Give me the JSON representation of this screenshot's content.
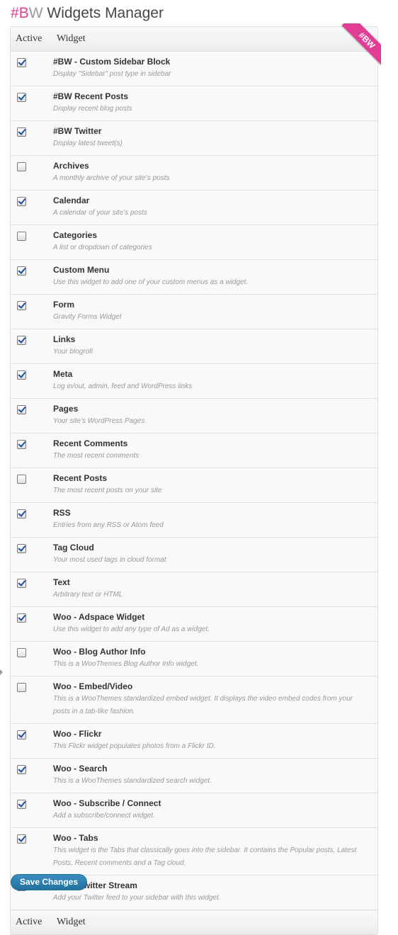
{
  "header": {
    "brand_hash": "#",
    "brand_b": "B",
    "brand_w": "W",
    "title": "Widgets Manager"
  },
  "ribbon": {
    "label": "#BW"
  },
  "columns": {
    "active": "Active",
    "widget": "Widget"
  },
  "widgets": [
    {
      "name": "#BW - Custom Sidebar Block",
      "desc": "Display \"Sidebar\" post type in sidebar",
      "active": true
    },
    {
      "name": "#BW Recent Posts",
      "desc": "Display recent blog posts",
      "active": true
    },
    {
      "name": "#BW Twitter",
      "desc": "Display latest tweet(s)",
      "active": true
    },
    {
      "name": "Archives",
      "desc": "A monthly archive of your site’s posts",
      "active": false
    },
    {
      "name": "Calendar",
      "desc": "A calendar of your site’s posts",
      "active": true
    },
    {
      "name": "Categories",
      "desc": "A list or dropdown of categories",
      "active": false
    },
    {
      "name": "Custom Menu",
      "desc": "Use this widget to add one of your custom menus as a widget.",
      "active": true
    },
    {
      "name": "Form",
      "desc": "Gravity Forms Widget",
      "active": true
    },
    {
      "name": "Links",
      "desc": "Your blogroll",
      "active": true
    },
    {
      "name": "Meta",
      "desc": "Log in/out, admin, feed and WordPress links",
      "active": true
    },
    {
      "name": "Pages",
      "desc": "Your site’s WordPress Pages",
      "active": true
    },
    {
      "name": "Recent Comments",
      "desc": "The most recent comments",
      "active": true
    },
    {
      "name": "Recent Posts",
      "desc": "The most recent posts on your site",
      "active": false
    },
    {
      "name": "RSS",
      "desc": "Entries from any RSS or Atom feed",
      "active": true
    },
    {
      "name": "Tag Cloud",
      "desc": "Your most used tags in cloud format",
      "active": true
    },
    {
      "name": "Text",
      "desc": "Arbitrary text or HTML",
      "active": true
    },
    {
      "name": "Woo - Adspace Widget",
      "desc": "Use this widget to add any type of Ad as a widget.",
      "active": true
    },
    {
      "name": "Woo - Blog Author Info",
      "desc": "This is a WooThemes Blog Author Info widget.",
      "active": false
    },
    {
      "name": "Woo - Embed/Video",
      "desc": "This is a WooThemes standardized embed widget. It displays the video embed codes from your posts in a tab-like fashion.",
      "active": false
    },
    {
      "name": "Woo - Flickr",
      "desc": "This Flickr widget populates photos from a Flickr ID.",
      "active": true
    },
    {
      "name": "Woo - Search",
      "desc": "This is a WooThemes standardized search widget.",
      "active": true
    },
    {
      "name": "Woo - Subscribe / Connect",
      "desc": "Add a subscribe/connect widget.",
      "active": true
    },
    {
      "name": "Woo - Tabs",
      "desc": "This widget is the Tabs that classically goes into the sidebar. It contains the Popular posts, Latest Posts, Recent comments and a Tag cloud.",
      "active": true
    },
    {
      "name": "Woo - Twitter Stream",
      "desc": "Add your Twitter feed to your sidebar with this widget.",
      "active": true
    }
  ],
  "save_label": "Save Changes",
  "colors": {
    "brand_pink": "#e23c93",
    "button_blue": "#2a7cad",
    "check_blue": "#1f4f9c"
  }
}
